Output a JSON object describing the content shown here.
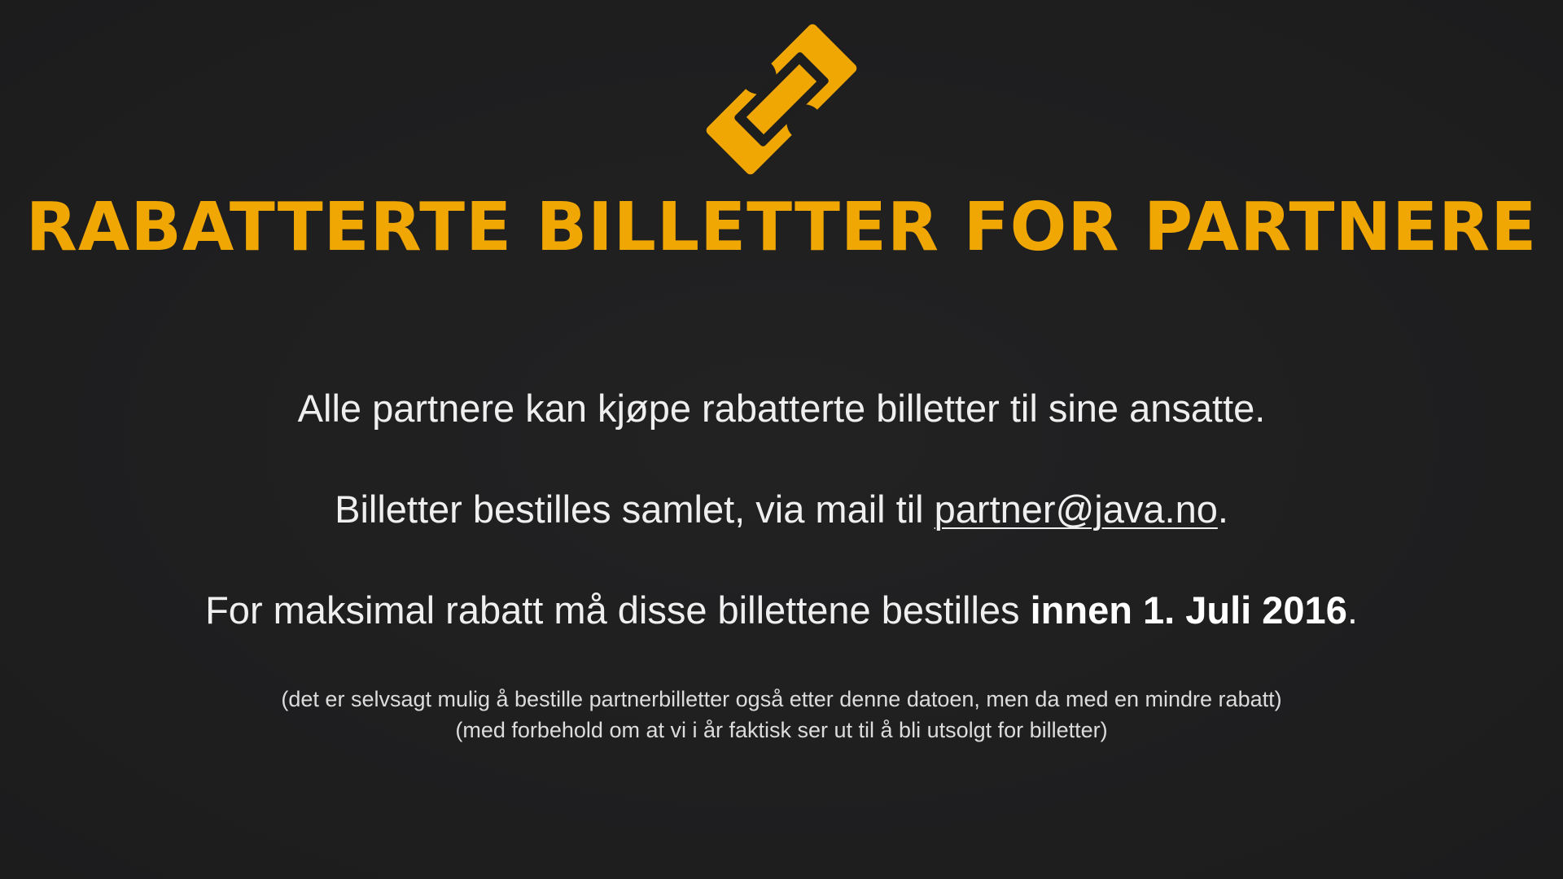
{
  "colors": {
    "background": "#1e1e1f",
    "accent": "#f0a603",
    "text": "#efefef"
  },
  "icon": "ticket-icon",
  "title": "RABATTERTE BILLETTER FOR PARTNERE",
  "lines": {
    "line1": "Alle partnere kan kjøpe rabatterte billetter til sine ansatte.",
    "line2_prefix": "Billetter bestilles samlet, via mail til ",
    "line2_email": "partner@java.no",
    "line2_suffix": ".",
    "line3_prefix": "For maksimal rabatt må disse billettene bestilles ",
    "line3_emphasis": "innen 1. Juli 2016",
    "line3_suffix": "."
  },
  "notes": {
    "note1": "(det er selvsagt mulig å bestille partnerbilletter også etter denne datoen, men da med en mindre rabatt)",
    "note2": "(med forbehold om at vi i år faktisk ser ut til å bli utsolgt for billetter)"
  }
}
